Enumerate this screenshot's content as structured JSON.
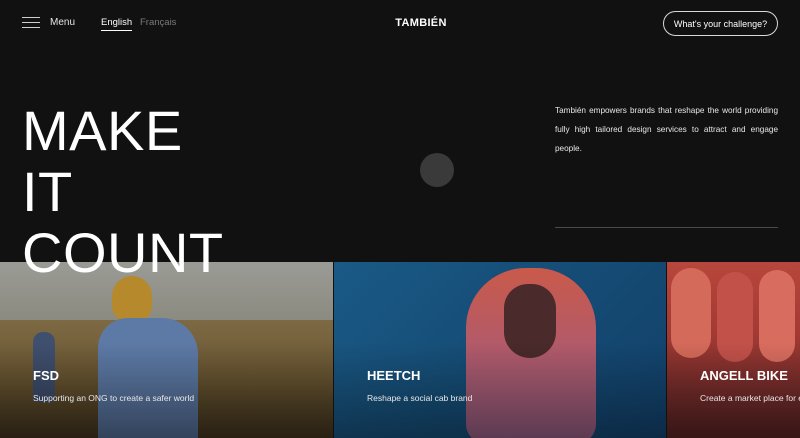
{
  "header": {
    "menu_label": "Menu",
    "languages": [
      {
        "label": "English",
        "active": true
      },
      {
        "label": "Français",
        "active": false
      }
    ],
    "logo": "TAMBIÉN",
    "cta_label": "What's your challenge?"
  },
  "hero": {
    "title_lines": [
      "MAKE",
      "IT",
      "COUNT"
    ],
    "tagline": "También empowers brands that reshape the world providing fully high tailored design services to attract and engage people."
  },
  "projects": [
    {
      "title": "FSD",
      "subtitle": "Supporting an ONG to create a safer world"
    },
    {
      "title": "HEETCH",
      "subtitle": "Reshape a social cab brand"
    },
    {
      "title": "ANGELL BIKE",
      "subtitle": "Create a market place for electric bikes"
    }
  ],
  "colors": {
    "background": "#111111",
    "text": "#ffffff",
    "muted_text": "#7b7b7b",
    "button_border": "#d9d9d9"
  },
  "icons": {
    "menu": "hamburger-icon"
  }
}
